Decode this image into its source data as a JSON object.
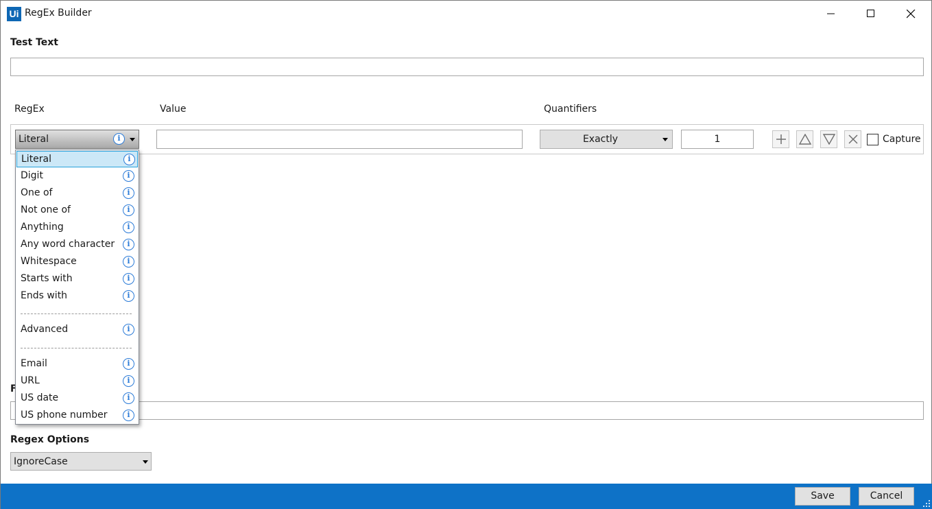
{
  "window": {
    "logo_text": "Ui",
    "title": "RegEx Builder"
  },
  "test_text": {
    "label": "Test Text",
    "value": ""
  },
  "columns": {
    "regex": "RegEx",
    "value": "Value",
    "quantifiers": "Quantifiers"
  },
  "row": {
    "regex_type": "Literal",
    "value": "",
    "quantifier": "Exactly",
    "count": "1",
    "capture_label": "Capture",
    "capture_checked": false
  },
  "dropdown": {
    "items": [
      {
        "label": "Literal",
        "selected": true
      },
      {
        "label": "Digit"
      },
      {
        "label": "One of"
      },
      {
        "label": "Not one of"
      },
      {
        "label": "Anything"
      },
      {
        "label": "Any word character"
      },
      {
        "label": "Whitespace"
      },
      {
        "label": "Starts with"
      },
      {
        "label": "Ends with"
      },
      {
        "separator": "--------------------------------"
      },
      {
        "label": "Advanced"
      },
      {
        "separator": "--------------------------------"
      },
      {
        "label": "Email"
      },
      {
        "label": "URL"
      },
      {
        "label": "US date"
      },
      {
        "label": "US phone number"
      }
    ]
  },
  "hidden_label_fragment": "F",
  "regex_options": {
    "label": "Regex Options",
    "value": "IgnoreCase"
  },
  "footer": {
    "save_label": "Save",
    "cancel_label": "Cancel"
  },
  "colors": {
    "accent": "#0e72c7",
    "logo": "#0e67b4",
    "info_icon": "#2b7bd8",
    "selection": "#cce8f7"
  }
}
